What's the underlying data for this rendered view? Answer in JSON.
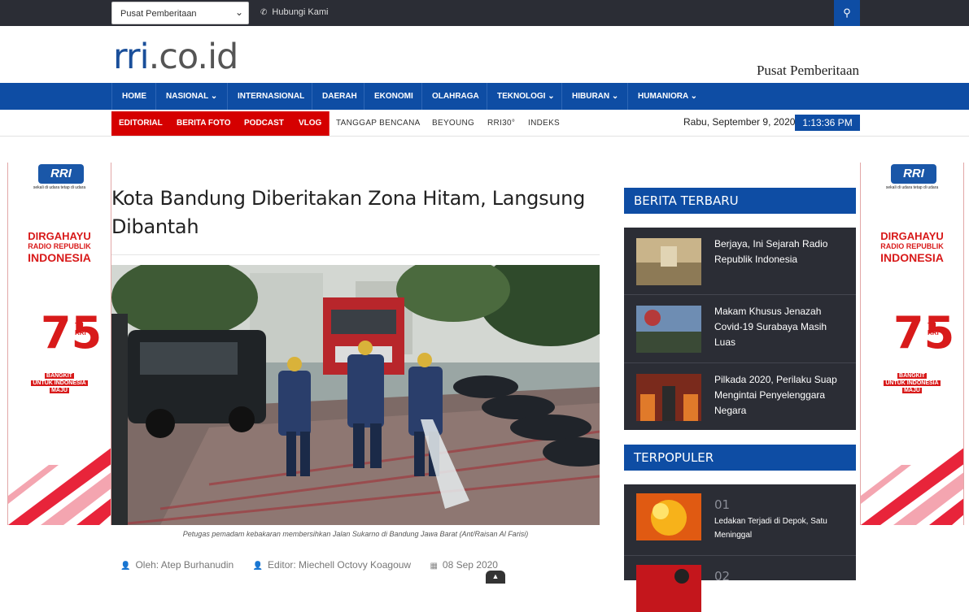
{
  "topbar": {
    "select_value": "Pusat Pemberitaan",
    "contact": "Hubungi Kami"
  },
  "header": {
    "logo_main": "rri",
    "logo_domain": ".co.id",
    "tagline": "Pusat Pemberitaan"
  },
  "nav": {
    "items": [
      "HOME",
      "NASIONAL",
      "INTERNASIONAL",
      "DAERAH",
      "EKONOMI",
      "OLAHRAGA",
      "TEKNOLOGI",
      "HIBURAN",
      "HUMANIORA"
    ]
  },
  "subnav": {
    "red_items": [
      "EDITORIAL",
      "BERITA FOTO",
      "PODCAST",
      "VLOG"
    ],
    "items": [
      "TANGGAP BENCANA",
      "BEYOUNG",
      "RRI30°",
      "INDEKS"
    ]
  },
  "datetime": {
    "date": "Rabu, September 9, 2020",
    "time": "1:13:36 PM"
  },
  "banner": {
    "logo": "RRI",
    "slogan": "sekali di udara tetap di udara",
    "line1": "DIRGAHAYU",
    "line2": "RADIO REPUBLIK",
    "line3": "INDONESIA",
    "anniv": "75",
    "anniv_suffix": "TH",
    "anniv_org": "RRI",
    "motto1": "BANGKIT",
    "motto2": "UNTUK INDONESIA",
    "motto3": "MAJU"
  },
  "article": {
    "title": "Kota Bandung Diberitakan Zona Hitam, Langsung Dibantah",
    "caption": "Petugas pemadam kebakaran membersihkan Jalan Sukarno di Bandung Jawa Barat (Ant/Raisan Al Farisi)",
    "author": "Oleh: Atep Burhanudin",
    "editor": "Editor: Miechell Octovy Koagouw",
    "date": "08 Sep 2020"
  },
  "sidebar": {
    "latest_title": "BERITA TERBARU",
    "latest": [
      "Berjaya, Ini Sejarah Radio Republik Indonesia",
      "Makam Khusus Jenazah Covid-19 Surabaya Masih Luas",
      "Pilkada 2020, Perilaku Suap Mengintai Penyelenggara Negara"
    ],
    "popular_title": "TERPOPULER",
    "popular": [
      {
        "num": "01",
        "title": "Ledakan Terjadi di Depok, Satu Meninggal"
      },
      {
        "num": "02",
        "title": ""
      }
    ]
  },
  "colors": {
    "brand_blue": "#0e4da4",
    "red": "#d50000",
    "dark": "#2b2d35"
  }
}
